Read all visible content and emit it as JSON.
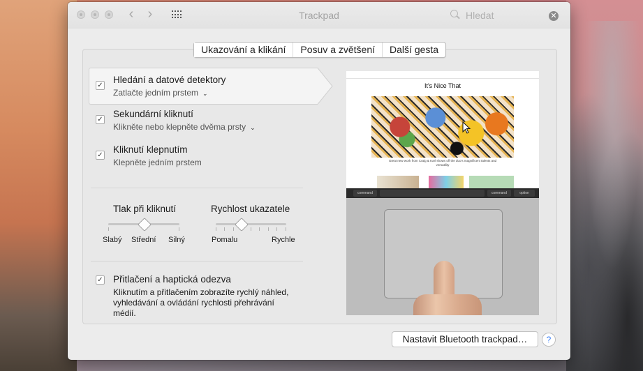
{
  "window": {
    "title": "Trackpad"
  },
  "search": {
    "placeholder": "Hledat"
  },
  "tabs": [
    {
      "label": "Ukazování a klikání"
    },
    {
      "label": "Posuv a zvětšení"
    },
    {
      "label": "Další gesta"
    }
  ],
  "options": [
    {
      "title": "Hledání a datové detektory",
      "subtitle": "Zatlačte jedním prstem",
      "checked": true,
      "has_menu": true
    },
    {
      "title": "Sekundární kliknutí",
      "subtitle": "Klikněte nebo klepněte dvěma prsty",
      "checked": true,
      "has_menu": true
    },
    {
      "title": "Kliknutí klepnutím",
      "subtitle": "Klepněte jedním prstem",
      "checked": true,
      "has_menu": false
    }
  ],
  "sliders": {
    "click": {
      "label": "Tlak při kliknutí",
      "min_label": "Slabý",
      "mid_label": "Střední",
      "max_label": "Silný",
      "value": 0.5
    },
    "speed": {
      "label": "Rychlost ukazatele",
      "min_label": "Pomalu",
      "max_label": "Rychle",
      "value": 0.35
    }
  },
  "haptic": {
    "title": "Přitlačení a haptická odezva",
    "checked": true,
    "description": "Kliknutím a přitlačením zobrazíte rychlý náhled, vyhledávání a ovládání rychlosti přehrávání médií."
  },
  "preview": {
    "site_title": "It's Nice That",
    "caption": "Great new work from Craig & Karl shows off the duo's magnificent talents and versatility",
    "keys": [
      "command",
      "command",
      "option"
    ]
  },
  "footer": {
    "bluetooth_button": "Nastavit Bluetooth trackpad…",
    "help_label": "?"
  },
  "colors": {
    "help_accent": "#3c80f6",
    "window_bg": "#ececec"
  }
}
